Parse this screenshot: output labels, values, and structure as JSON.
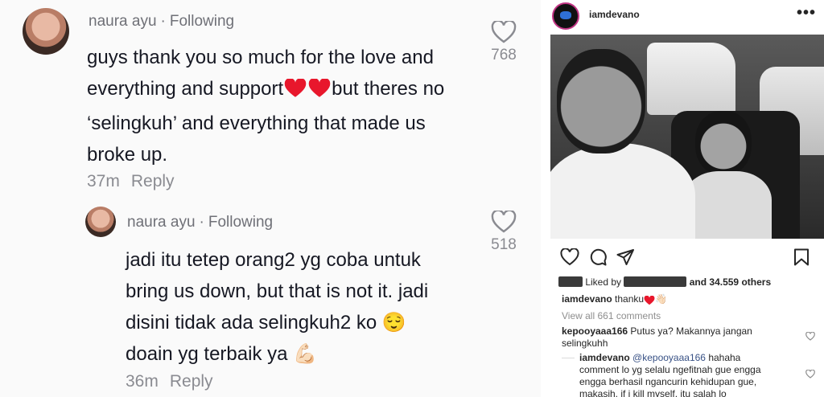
{
  "tiktok": {
    "comment1": {
      "username": "naura ayu",
      "separator": "·",
      "follow_status": "Following",
      "lines": [
        "guys thank you so much for the love and",
        "everything and support",
        "but theres no",
        "‘selingkuh’ and everything that made us",
        "broke up."
      ],
      "time": "37m",
      "reply_label": "Reply",
      "like_count": "768"
    },
    "comment2": {
      "username": "naura ayu",
      "separator": "·",
      "follow_status": "Following",
      "lines": [
        "jadi itu tetep orang2 yg coba untuk",
        "bring us down, but that is not it. jadi",
        "disini tidak ada selingkuh2 ko",
        "doain yg terbaik ya"
      ],
      "emoji_relieved": "😌",
      "emoji_muscle": "💪🏻",
      "time": "36m",
      "reply_label": "Reply",
      "like_count": "518"
    },
    "colors": {
      "heart_red": "#e8172c",
      "muted": "#8a8b91"
    }
  },
  "instagram": {
    "username": "iamdevano",
    "more_icon": "•••",
    "likes": {
      "prefix": "Liked by",
      "suffix": "and 34.559 others"
    },
    "caption": {
      "user": "iamdevano",
      "text": "thanku",
      "emoji_wave": "👋🏻"
    },
    "view_all": "View all 661 comments",
    "comment1": {
      "user": "kepooyaaa166",
      "text": "Putus ya? Makannya jangan selingkuhh"
    },
    "comment2": {
      "user": "iamdevano",
      "mention": "@kepooyaaa166",
      "text": "hahaha comment lo yg selalu ngefitnah gue engga engga berhasil ngancurin kehidupan gue, makasih. if i kill myself. itu salah lo"
    }
  }
}
